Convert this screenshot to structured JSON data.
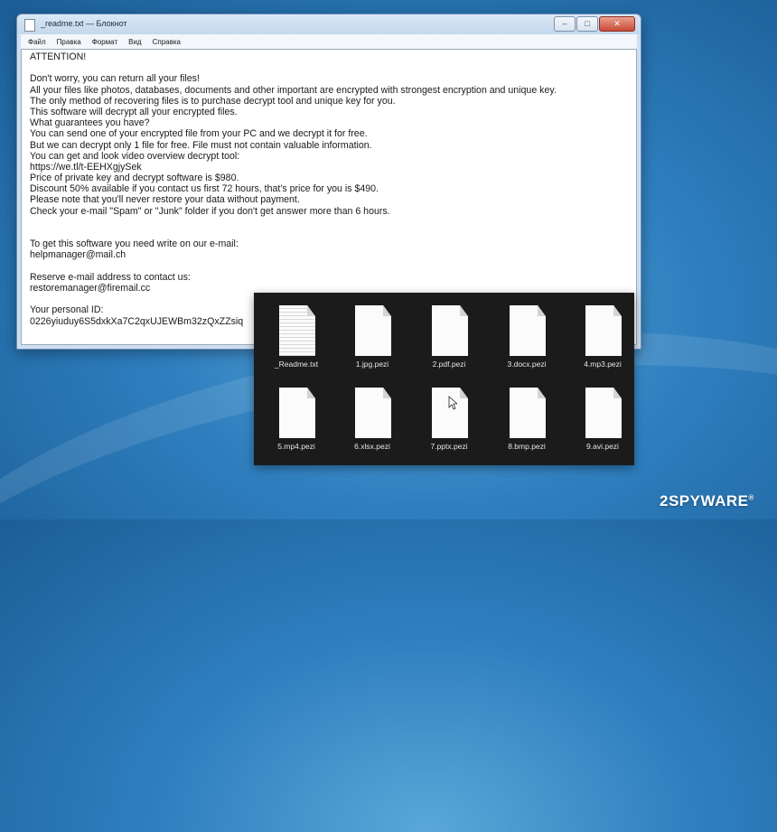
{
  "window": {
    "title": "_readme.txt — Блокнот",
    "menu": [
      "Файл",
      "Правка",
      "Формат",
      "Вид",
      "Справка"
    ]
  },
  "note": {
    "lines": [
      "ATTENTION!",
      "",
      "Don't worry, you can return all your files!",
      "All your files like photos, databases, documents and other important are encrypted with strongest encryption and unique key.",
      "The only method of recovering files is to purchase decrypt tool and unique key for you.",
      "This software will decrypt all your encrypted files.",
      "What guarantees you have?",
      "You can send one of your encrypted file from your PC and we decrypt it for free.",
      "But we can decrypt only 1 file for free. File must not contain valuable information.",
      "You can get and look video overview decrypt tool:",
      "https://we.tl/t-EEHXgjySek",
      "Price of private key and decrypt software is $980.",
      "Discount 50% available if you contact us first 72 hours, that's price for you is $490.",
      "Please note that you'll never restore your data without payment.",
      "Check your e-mail \"Spam\" or \"Junk\" folder if you don't get answer more than 6 hours.",
      "",
      "",
      "To get this software you need write on our e-mail:",
      "helpmanager@mail.ch",
      "",
      "Reserve e-mail address to contact us:",
      "restoremanager@firemail.cc",
      "",
      "Your personal ID:",
      "0226yiuduy6S5dxkXa7C2qxUJEWBm32zQxZZsiq"
    ]
  },
  "files": [
    {
      "name": "_Readme.txt",
      "icon": "text-document-icon"
    },
    {
      "name": "1.jpg.pezi",
      "icon": "blank-file-icon"
    },
    {
      "name": "2.pdf.pezi",
      "icon": "blank-file-icon"
    },
    {
      "name": "3.docx.pezi",
      "icon": "blank-file-icon"
    },
    {
      "name": "4.mp3.pezi",
      "icon": "blank-file-icon"
    },
    {
      "name": "5.mp4.pezi",
      "icon": "blank-file-icon"
    },
    {
      "name": "6.xlsx.pezi",
      "icon": "blank-file-icon"
    },
    {
      "name": "7.pptx.pezi",
      "icon": "blank-file-icon"
    },
    {
      "name": "8.bmp.pezi",
      "icon": "blank-file-icon"
    },
    {
      "name": "9.avi.pezi",
      "icon": "blank-file-icon"
    }
  ],
  "watermark": {
    "text": "2SPYWARE",
    "mark": "®"
  }
}
